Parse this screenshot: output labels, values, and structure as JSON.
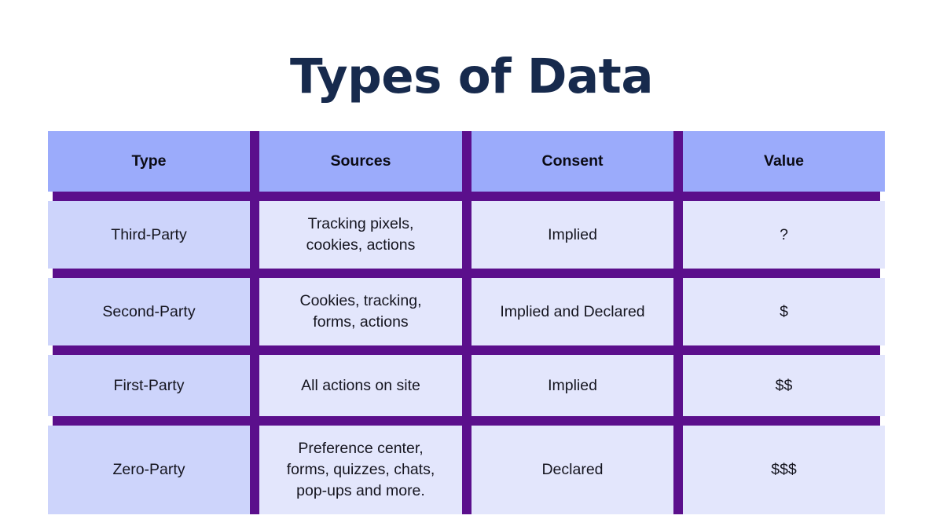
{
  "title": "Types of Data",
  "colors": {
    "title": "#172a4d",
    "header_bg": "#9babfb",
    "first_col_bg": "#cdd4fb",
    "body_bg": "#e3e6fc",
    "divider": "#5b0f8c"
  },
  "table": {
    "headers": [
      "Type",
      "Sources",
      "Consent",
      "Value"
    ],
    "rows": [
      [
        "Third-Party",
        "Tracking pixels,\ncookies, actions",
        "Implied",
        "?"
      ],
      [
        "Second-Party",
        "Cookies, tracking,\nforms, actions",
        "Implied and Declared",
        "$"
      ],
      [
        "First-Party",
        "All actions on site",
        "Implied",
        "$$"
      ],
      [
        "Zero-Party",
        "Preference center,\nforms, quizzes, chats,\npop-ups and more.",
        "Declared",
        "$$$"
      ]
    ]
  }
}
